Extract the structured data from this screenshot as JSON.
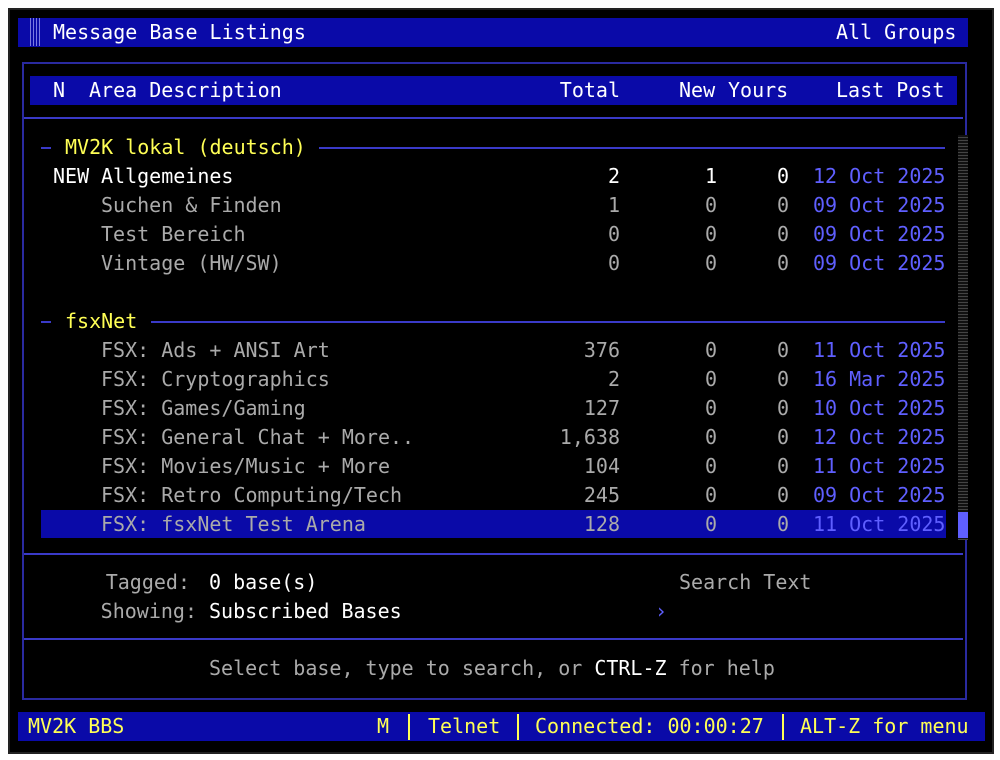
{
  "title": "Message Base Listings",
  "scope": "All Groups",
  "columns": {
    "n": "N",
    "desc": "Area Description",
    "total": "Total",
    "new": "New",
    "yours": "Yours",
    "last": "Last Post"
  },
  "groups": [
    {
      "name": "MV2K lokal (deutsch)",
      "rows": [
        {
          "flag": "NEW",
          "name": "Allgemeines",
          "total": "2",
          "new": "1",
          "yours": "0",
          "last": "12 Oct 2025"
        },
        {
          "flag": "",
          "name": "Suchen & Finden",
          "total": "1",
          "new": "0",
          "yours": "0",
          "last": "09 Oct 2025"
        },
        {
          "flag": "",
          "name": "Test Bereich",
          "total": "0",
          "new": "0",
          "yours": "0",
          "last": "09 Oct 2025"
        },
        {
          "flag": "",
          "name": "Vintage (HW/SW)",
          "total": "0",
          "new": "0",
          "yours": "0",
          "last": "09 Oct 2025"
        }
      ]
    },
    {
      "name": "fsxNet",
      "rows": [
        {
          "flag": "",
          "name": "FSX: Ads + ANSI Art",
          "total": "376",
          "new": "0",
          "yours": "0",
          "last": "11 Oct 2025"
        },
        {
          "flag": "",
          "name": "FSX: Cryptographics",
          "total": "2",
          "new": "0",
          "yours": "0",
          "last": "16 Mar 2025"
        },
        {
          "flag": "",
          "name": "FSX: Games/Gaming",
          "total": "127",
          "new": "0",
          "yours": "0",
          "last": "10 Oct 2025"
        },
        {
          "flag": "",
          "name": "FSX: General Chat + More..",
          "total": "1,638",
          "new": "0",
          "yours": "0",
          "last": "12 Oct 2025"
        },
        {
          "flag": "",
          "name": "FSX: Movies/Music + More",
          "total": "104",
          "new": "0",
          "yours": "0",
          "last": "11 Oct 2025"
        },
        {
          "flag": "",
          "name": "FSX: Retro Computing/Tech",
          "total": "245",
          "new": "0",
          "yours": "0",
          "last": "09 Oct 2025"
        },
        {
          "flag": "",
          "name": "FSX: fsxNet Test Arena",
          "total": "128",
          "new": "0",
          "yours": "0",
          "last": "11 Oct 2025",
          "selected": true
        }
      ]
    }
  ],
  "footer": {
    "tagged_label": "Tagged:",
    "tagged_value": "0 base(s)",
    "showing_label": "Showing:",
    "showing_value": "Subscribed Bases",
    "search_label": "Search Text",
    "search_prompt": "›"
  },
  "help": {
    "pre": "Select base, type to search, or ",
    "key": "CTRL-Z",
    "post": " for help"
  },
  "status": {
    "bbs": "MV2K BBS",
    "mode": "M",
    "proto": "Telnet",
    "connected": "Connected: 00:00:27",
    "menu": "ALT-Z for menu"
  }
}
